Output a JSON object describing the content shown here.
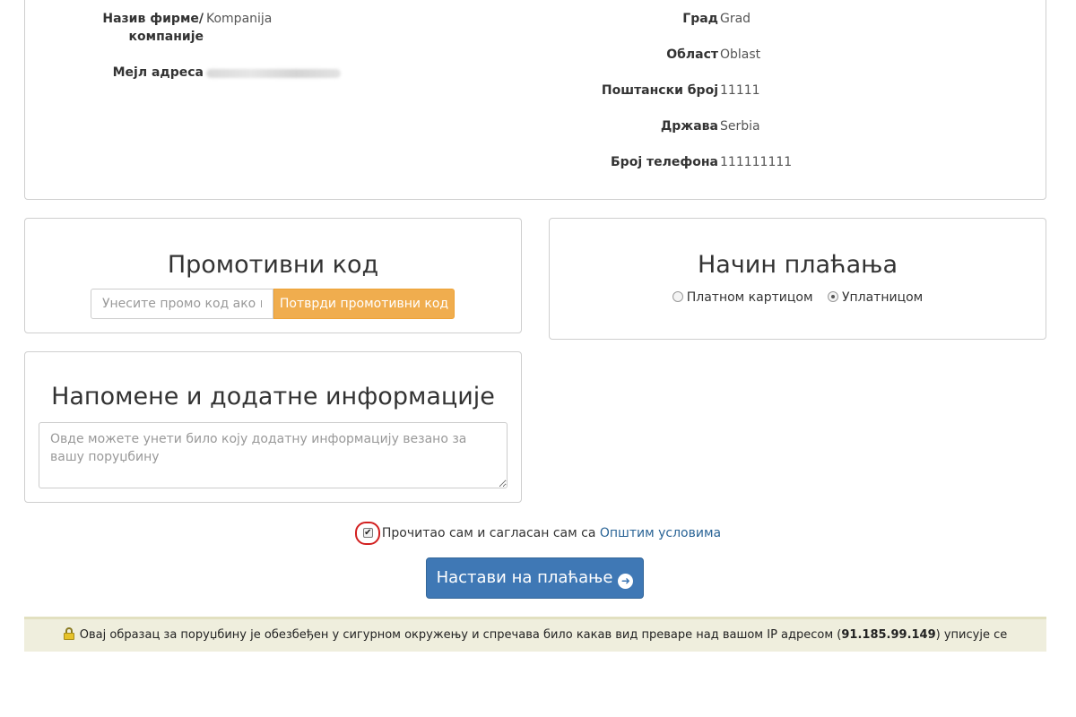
{
  "company_info": {
    "company_label_line1": "Назив фирме/",
    "company_label_line2": "компаније",
    "company_value": "Kompanija",
    "email_label": "Мејл адреса",
    "city_label": "Град",
    "city_value": "Grad",
    "region_label": "Област",
    "region_value": "Oblast",
    "postal_label": "Поштански број",
    "postal_value": "11111",
    "country_label": "Држава",
    "country_value": "Serbia",
    "phone_label": "Број телефона",
    "phone_value": "111111111"
  },
  "promo": {
    "title": "Промотивни код",
    "input_placeholder": "Унесите промо код ако га",
    "button_label": "Потврди промотивни код",
    "button_color": "#f0ad4e"
  },
  "payment": {
    "title": "Начин плаћања",
    "options": [
      {
        "label": "Платном картицом",
        "selected": false
      },
      {
        "label": "Уплатницом",
        "selected": true
      }
    ]
  },
  "notes": {
    "title": "Напомене и додатне информације",
    "placeholder": "Овде можете унети било коју додатну информацију везано за вашу поруџбину"
  },
  "terms": {
    "checked": true,
    "text": "Прочитао сам и сагласан сам са",
    "link_text": "Општим условима"
  },
  "continue_button": {
    "label": "Настави на плаћање",
    "icon": "arrow-circle-right-icon",
    "color": "#3f78b5"
  },
  "security_notice": {
    "icon": "lock-icon",
    "text_before": "Овај образац за поруџбину је обезбеђен у сигурном окружењу и спречава било какав вид преваре над вашом IP адресом (",
    "ip": "91.185.99.149",
    "text_after": ") уписује се"
  }
}
